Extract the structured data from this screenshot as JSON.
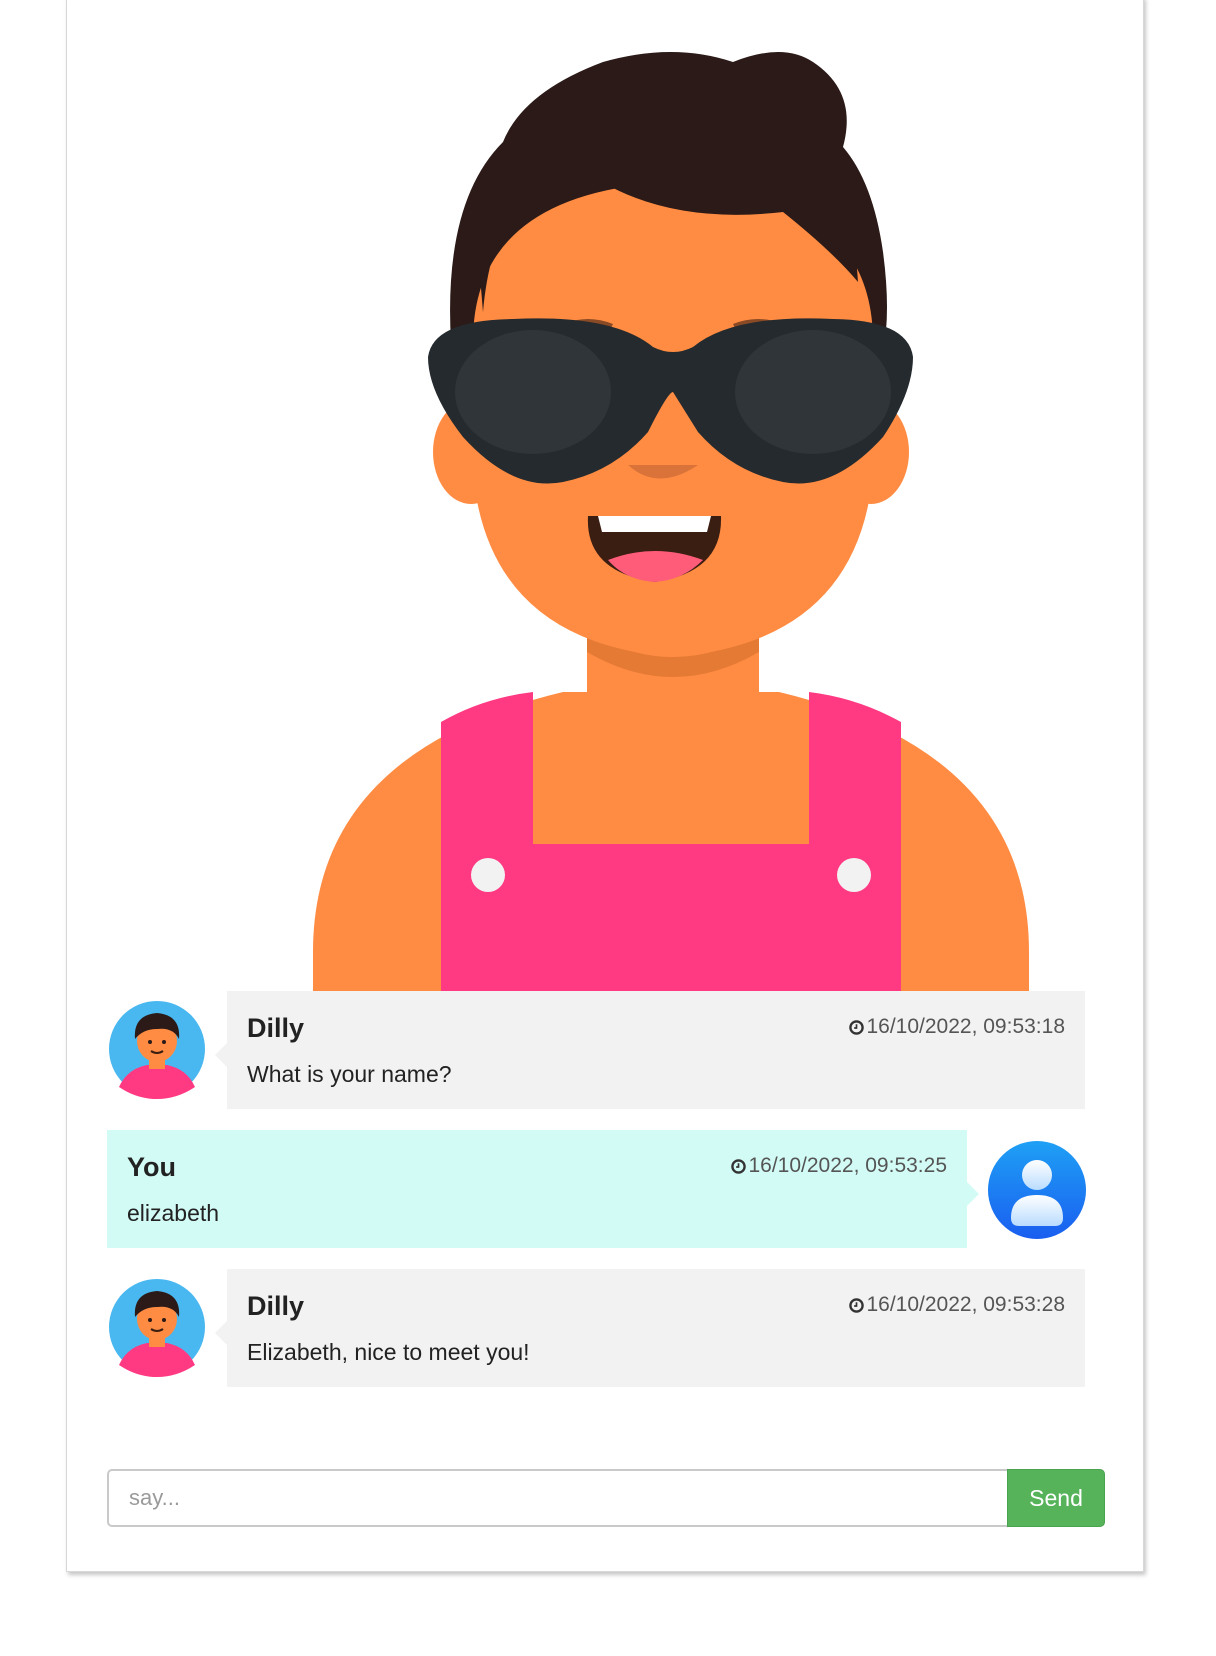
{
  "bot": {
    "name": "Dilly"
  },
  "user": {
    "name": "You"
  },
  "colors": {
    "skin": "#ff8c42",
    "hair": "#2b1a17",
    "overalls": "#ff3a83",
    "glasses": "#252a2e",
    "bot_bubble": "#f2f2f2",
    "user_bubble": "#d3fbf6",
    "send_button": "#56b35a",
    "avatar_bg": "#4ab8f0"
  },
  "messages": [
    {
      "sender": "Dilly",
      "role": "bot",
      "time": "16/10/2022, 09:53:18",
      "text": "What is your name?"
    },
    {
      "sender": "You",
      "role": "user",
      "time": "16/10/2022, 09:53:25",
      "text": "elizabeth"
    },
    {
      "sender": "Dilly",
      "role": "bot",
      "time": "16/10/2022, 09:53:28",
      "text": "Elizabeth, nice to meet you!"
    }
  ],
  "composer": {
    "placeholder": "say...",
    "value": "",
    "send_label": "Send"
  },
  "icons": {
    "clock": "clock-icon",
    "user_avatar": "user-avatar-icon",
    "bot_avatar": "bot-avatar-icon"
  }
}
